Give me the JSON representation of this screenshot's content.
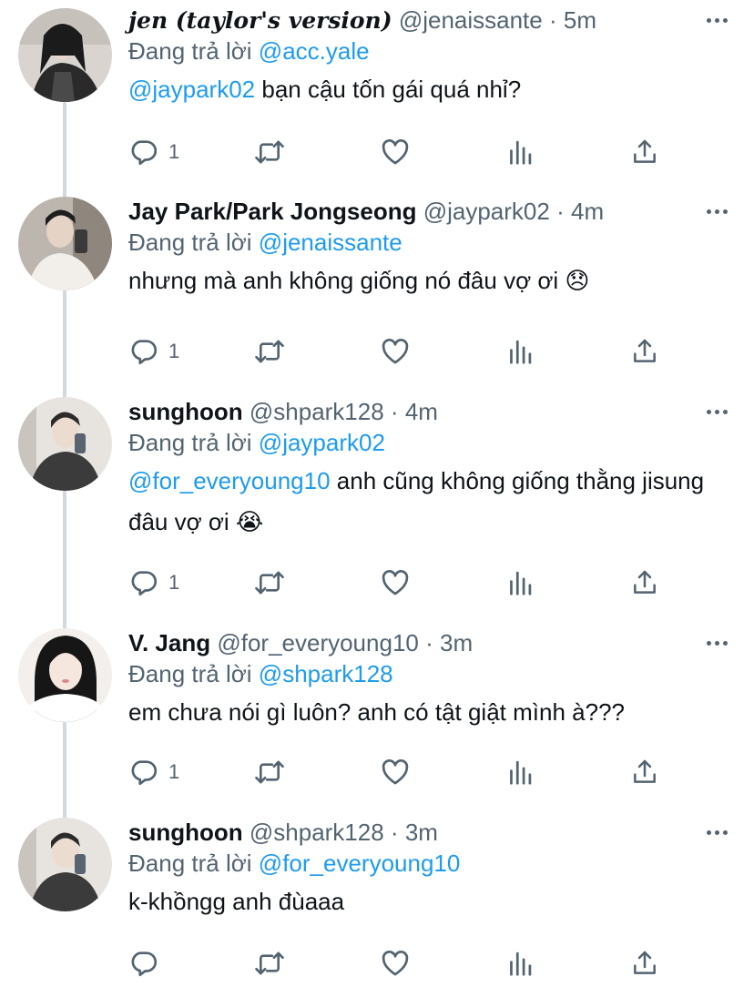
{
  "tweets": [
    {
      "name": "jen (taylor's version)",
      "handle": "@jenaissante",
      "separator": "·",
      "time": "5m",
      "replying_prefix": "Đang trả lời",
      "replying_to": "@acc.yale",
      "mention": "@jaypark02",
      "text": " bạn cậu tốn gái quá nhỉ?",
      "reply_count": "1"
    },
    {
      "name": "Jay Park/Park Jongseong",
      "handle": "@jaypark02",
      "separator": "·",
      "time": "4m",
      "replying_prefix": "Đang trả lời",
      "replying_to": "@jenaissante",
      "mention": "",
      "text": "nhưng mà anh không giống nó đâu vợ ơi 😞",
      "reply_count": "1"
    },
    {
      "name": "sunghoon",
      "handle": "@shpark128",
      "separator": "·",
      "time": "4m",
      "replying_prefix": "Đang trả lời",
      "replying_to": "@jaypark02",
      "mention": "@for_everyoung10",
      "text": " anh cũng không giống thằng jisung đâu vợ ơi 😭",
      "reply_count": "1"
    },
    {
      "name": "V. Jang",
      "handle": "@for_everyoung10",
      "separator": "·",
      "time": "3m",
      "replying_prefix": "Đang trả lời",
      "replying_to": "@shpark128",
      "mention": "",
      "text": "em chưa nói gì luôn? anh có tật giật mình à???",
      "reply_count": "1"
    },
    {
      "name": "sunghoon",
      "handle": "@shpark128",
      "separator": "·",
      "time": "3m",
      "replying_prefix": "Đang trả lời",
      "replying_to": "@for_everyoung10",
      "mention": "",
      "text": "k-khồngg anh đùaaa",
      "reply_count": ""
    }
  ],
  "icons": {
    "reply": "reply-icon",
    "retweet": "retweet-icon",
    "like": "heart-icon",
    "stats": "analytics-icon",
    "share": "share-icon",
    "more": "more-icon"
  },
  "colors": {
    "link": "#1d9bf0",
    "secondary_text": "#536471",
    "primary_text": "#0f1419",
    "thread_line": "#cfd9de"
  }
}
